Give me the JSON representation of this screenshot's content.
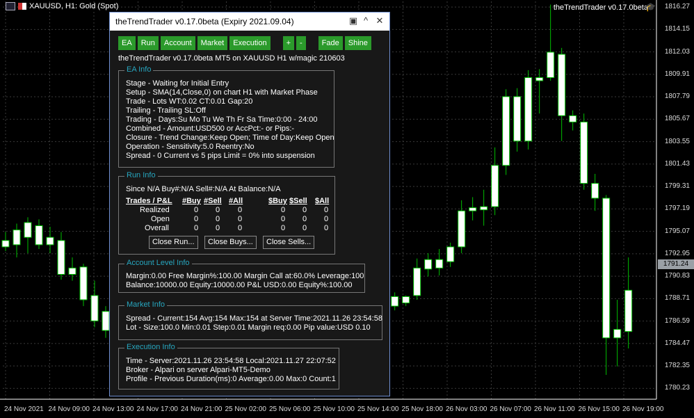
{
  "chart": {
    "symbol_label": "XAUUSD, H1:  Gold (Spot)",
    "ea_label": "theTrendTrader v0.17.0beta",
    "current_price_tag": "1791.24",
    "price_labels": [
      "1816.27",
      "1814.15",
      "1812.03",
      "1809.91",
      "1807.79",
      "1805.67",
      "1803.55",
      "1801.43",
      "1799.31",
      "1797.19",
      "1795.07",
      "1792.95",
      "1790.83",
      "1788.71",
      "1786.59",
      "1784.47",
      "1782.35",
      "1780.23"
    ],
    "time_labels": [
      "24 Nov 2021",
      "24 Nov 09:00",
      "24 Nov 13:00",
      "24 Nov 17:00",
      "24 Nov 21:00",
      "25 Nov 02:00",
      "25 Nov 06:00",
      "25 Nov 10:00",
      "25 Nov 14:00",
      "25 Nov 18:00",
      "26 Nov 03:00",
      "26 Nov 07:00",
      "26 Nov 11:00",
      "26 Nov 15:00",
      "26 Nov 19:00"
    ],
    "colors": {
      "bull": "#ffffff",
      "bear": "#ffffff",
      "wick": "#00c000",
      "grid": "#3a3a3a"
    }
  },
  "chart_data": {
    "type": "candlestick",
    "ylim": [
      1779.2,
      1816.8
    ],
    "candles": [
      {
        "o": 1794.2,
        "h": 1795.0,
        "l": 1793.2,
        "c": 1793.6
      },
      {
        "o": 1793.8,
        "h": 1795.8,
        "l": 1792.6,
        "c": 1795.2
      },
      {
        "o": 1794.5,
        "h": 1796.4,
        "l": 1793.0,
        "c": 1795.9
      },
      {
        "o": 1795.6,
        "h": 1796.2,
        "l": 1793.4,
        "c": 1793.8
      },
      {
        "o": 1794.5,
        "h": 1795.5,
        "l": 1793.0,
        "c": 1793.8
      },
      {
        "o": 1794.2,
        "h": 1795.0,
        "l": 1790.5,
        "c": 1791.0
      },
      {
        "o": 1791.6,
        "h": 1792.6,
        "l": 1790.4,
        "c": 1791.0
      },
      {
        "o": 1791.7,
        "h": 1792.0,
        "l": 1788.0,
        "c": 1788.6
      },
      {
        "o": 1789.0,
        "h": 1790.4,
        "l": 1786.0,
        "c": 1786.6
      },
      {
        "o": 1787.5,
        "h": 1788.0,
        "l": 1785.0,
        "c": 1785.7
      },
      {
        "o": 1790.6,
        "h": 1791.2,
        "l": 1787.6,
        "c": 1788.0
      },
      {
        "o": 1788.0,
        "h": 1789.3,
        "l": 1787.6,
        "c": 1788.9
      },
      {
        "o": 1788.9,
        "h": 1789.0,
        "l": 1788.0,
        "c": 1788.3
      },
      {
        "o": 1789.0,
        "h": 1792.5,
        "l": 1788.6,
        "c": 1791.6
      },
      {
        "o": 1791.5,
        "h": 1793.0,
        "l": 1790.8,
        "c": 1792.4
      },
      {
        "o": 1791.6,
        "h": 1793.4,
        "l": 1790.9,
        "c": 1792.4
      },
      {
        "o": 1792.2,
        "h": 1794.0,
        "l": 1791.7,
        "c": 1793.6
      },
      {
        "o": 1793.6,
        "h": 1798.0,
        "l": 1793.0,
        "c": 1797.0
      },
      {
        "o": 1797.0,
        "h": 1798.3,
        "l": 1796.1,
        "c": 1797.3
      },
      {
        "o": 1797.1,
        "h": 1799.0,
        "l": 1795.6,
        "c": 1797.4
      },
      {
        "o": 1797.4,
        "h": 1803.0,
        "l": 1796.6,
        "c": 1801.3
      },
      {
        "o": 1801.3,
        "h": 1808.5,
        "l": 1800.4,
        "c": 1807.8
      },
      {
        "o": 1807.8,
        "h": 1808.6,
        "l": 1802.6,
        "c": 1803.6
      },
      {
        "o": 1803.6,
        "h": 1810.3,
        "l": 1802.8,
        "c": 1809.6
      },
      {
        "o": 1809.6,
        "h": 1810.4,
        "l": 1806.2,
        "c": 1809.3
      },
      {
        "o": 1809.6,
        "h": 1816.5,
        "l": 1809.3,
        "c": 1812.0
      },
      {
        "o": 1811.8,
        "h": 1812.4,
        "l": 1803.6,
        "c": 1806.0
      },
      {
        "o": 1806.0,
        "h": 1806.5,
        "l": 1804.6,
        "c": 1805.4
      },
      {
        "o": 1805.4,
        "h": 1806.2,
        "l": 1799.0,
        "c": 1799.6
      },
      {
        "o": 1799.6,
        "h": 1800.5,
        "l": 1797.0,
        "c": 1798.2
      },
      {
        "o": 1798.2,
        "h": 1798.5,
        "l": 1781.5,
        "c": 1785.0
      },
      {
        "o": 1785.0,
        "h": 1788.6,
        "l": 1782.3,
        "c": 1785.8
      },
      {
        "o": 1785.6,
        "h": 1792.6,
        "l": 1784.0,
        "c": 1789.5
      }
    ]
  },
  "dialog": {
    "title": "theTrendTrader v0.17.0beta (Expiry 2021.09.04)",
    "buttons": [
      "EA",
      "Run",
      "Account",
      "Market",
      "Execution"
    ],
    "buttons2": [
      "+",
      "-"
    ],
    "buttons3": [
      "Fade",
      "Shine"
    ],
    "subtitle": "theTrendTrader v0.17.0beta MT5 on XAUUSD H1 w/magic 210603",
    "ea_info": {
      "title": "EA Info",
      "lines": [
        "Stage - Waiting for Initial Entry",
        "Setup - SMA(14,Close,0) on chart H1 with Market Phase",
        "Trade - Lots WT:0.02 CT:0.01 Gap:20",
        "Trailing - Trailing SL:Off",
        "Trading - Days:Su Mo Tu We Th Fr Sa Time:0:00 - 24:00",
        "Combined - Amount:USD500 or AccPct:- or Pips:-",
        "Closure - Trend Change:Keep Open; Time of Day:Keep Open",
        "Operation - Sensitivity:5.0 Reentry:No",
        "Spread - 0 Current vs 5 pips Limit = 0% into suspension"
      ]
    },
    "run_info": {
      "title": "Run Info",
      "since": "Since N/A Buy#:N/A Sell#:N/A At Balance:N/A",
      "headers": [
        "Trades / P&L",
        "#Buy",
        "#Sell",
        "#All",
        "$Buy",
        "$Sell",
        "$All"
      ],
      "rows": [
        {
          "label": "Realized",
          "vals": [
            "0",
            "0",
            "0",
            "0",
            "0",
            "0"
          ]
        },
        {
          "label": "Open",
          "vals": [
            "0",
            "0",
            "0",
            "0",
            "0",
            "0"
          ]
        },
        {
          "label": "Overall",
          "vals": [
            "0",
            "0",
            "0",
            "0",
            "0",
            "0"
          ]
        }
      ],
      "btn_close_run": "Close Run...",
      "btn_close_buys": "Close Buys...",
      "btn_close_sells": "Close Sells..."
    },
    "account_info": {
      "title": "Account Level Info",
      "lines": [
        "Margin:0.00 Free Margin%:100.00 Margin Call at:60.0% Leverage:100",
        "Balance:10000.00 Equity:10000.00 P&L USD:0.00 Equity%:100.00"
      ]
    },
    "market_info": {
      "title": "Market Info",
      "lines": [
        "Spread - Current:154 Avg:154 Max:154 at Server Time:2021.11.26 23:54:58",
        "Lot - Size:100.0 Min:0.01 Step:0.01 Margin req:0.00 Pip value:USD 0.10"
      ]
    },
    "execution_info": {
      "title": "Execution Info",
      "lines": [
        "Time - Server:2021.11.26 23:54:58 Local:2021.11.27 22:07:52",
        "Broker - Alpari on server Alpari-MT5-Demo",
        "Profile - Previous Duration(ms):0 Average:0.00 Max:0 Count:1"
      ]
    }
  }
}
